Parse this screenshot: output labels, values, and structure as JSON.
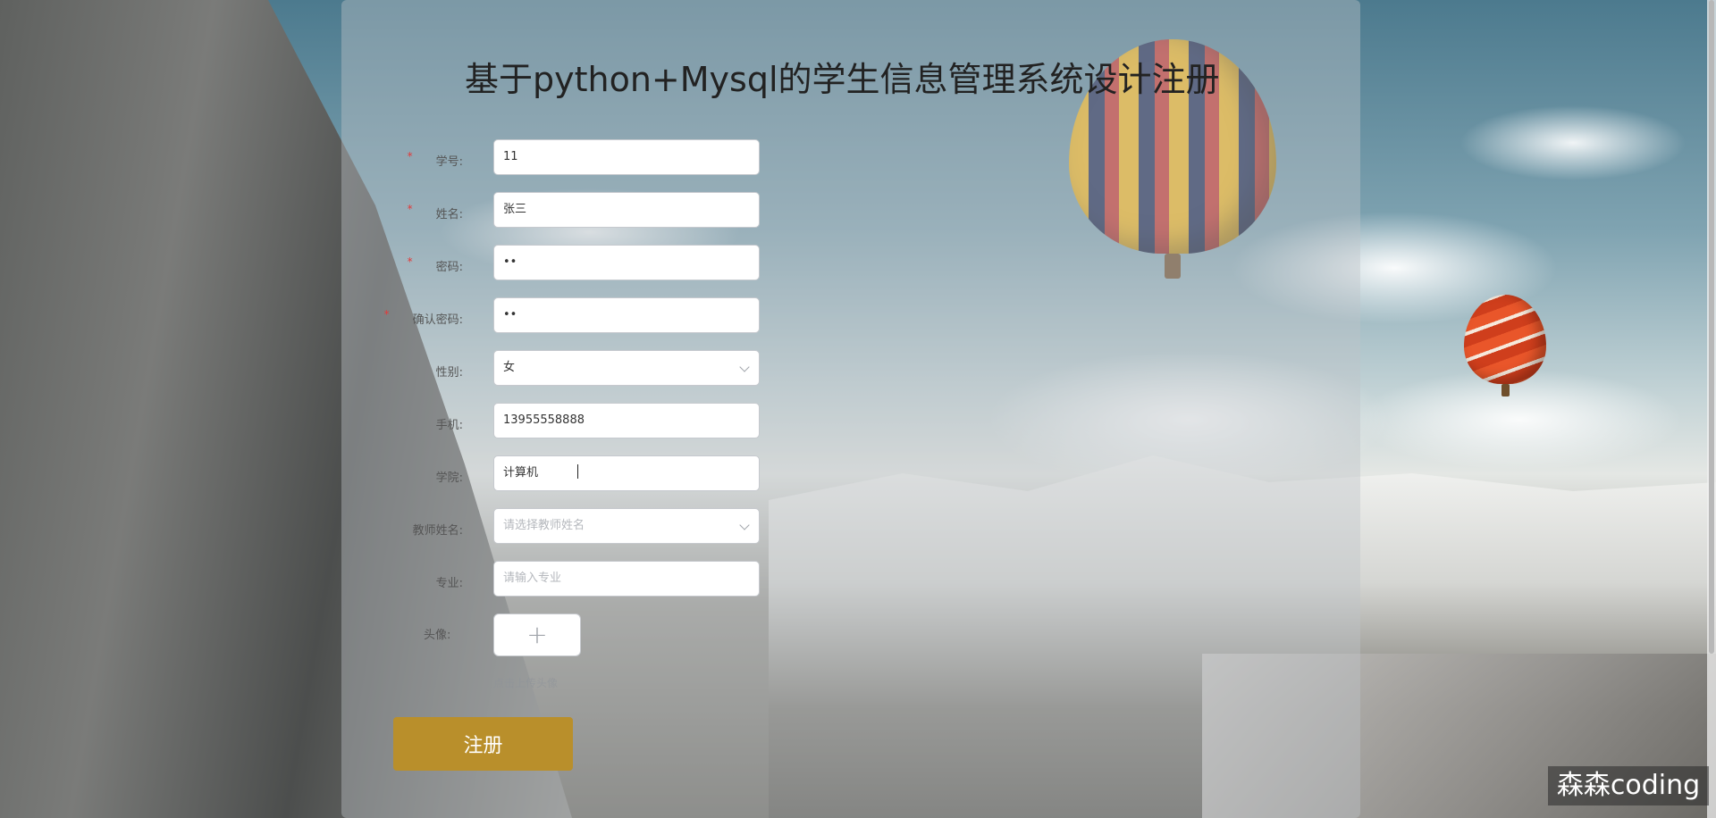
{
  "page": {
    "title": "基于python+Mysql的学生信息管理系统设计注册"
  },
  "form": {
    "fields": [
      {
        "label": "学号:",
        "value": "11",
        "placeholder": "",
        "required": true,
        "type": "text"
      },
      {
        "label": "姓名:",
        "value": "张三",
        "placeholder": "",
        "required": true,
        "type": "text"
      },
      {
        "label": "密码:",
        "value": "••",
        "placeholder": "",
        "required": true,
        "type": "password"
      },
      {
        "label": "确认密码:",
        "value": "••",
        "placeholder": "",
        "required": true,
        "type": "password"
      },
      {
        "label": "性别:",
        "value": "女",
        "placeholder": "",
        "required": false,
        "type": "select"
      },
      {
        "label": "手机:",
        "value": "13955558888",
        "placeholder": "",
        "required": false,
        "type": "text"
      },
      {
        "label": "学院:",
        "value": "计算机",
        "placeholder": "",
        "required": false,
        "type": "text"
      },
      {
        "label": "教师姓名:",
        "value": "",
        "placeholder": "请选择教师姓名",
        "required": false,
        "type": "select"
      },
      {
        "label": "专业:",
        "value": "",
        "placeholder": "请输入专业",
        "required": false,
        "type": "text"
      }
    ],
    "avatar": {
      "label": "头像:",
      "plus": "+",
      "hint": "点击上传头像"
    },
    "submit_label": "注册"
  },
  "watermark": "森森coding",
  "colors": {
    "submit": "#b98f2b",
    "required_star": "#e23a3a",
    "panel": "rgba(190,196,200,0.42)"
  }
}
